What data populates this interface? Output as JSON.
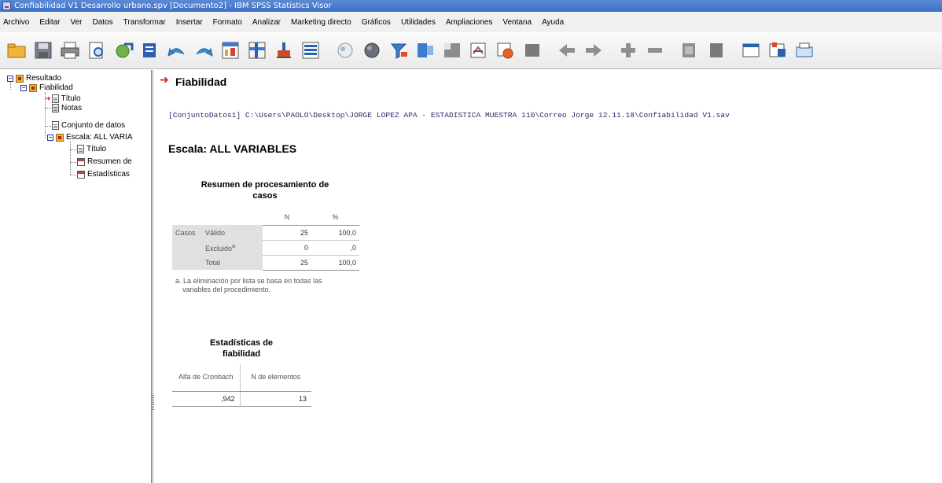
{
  "window": {
    "title": "Confiabilidad V1 Desarrollo urbano.spv [Documento2] - IBM SPSS Statistics Visor"
  },
  "menu": [
    "Archivo",
    "Editar",
    "Ver",
    "Datos",
    "Transformar",
    "Insertar",
    "Formato",
    "Analizar",
    "Marketing directo",
    "Gráficos",
    "Utilidades",
    "Ampliaciones",
    "Ventana",
    "Ayuda"
  ],
  "toolbar": {
    "icons": [
      "open-icon",
      "save-icon",
      "print-icon",
      "print-preview-icon",
      "export-icon",
      "recall-dialog-icon",
      "undo-icon",
      "redo-icon",
      "goto-data-icon",
      "goto-case-icon",
      "goto-variable-icon",
      "variables-icon",
      "designate-window-icon",
      "show-all-icon",
      "insert-output-icon",
      "select-last-output-icon",
      "create-edit-icon",
      "run-icon",
      "stop-icon",
      "promote-icon",
      "demote-icon",
      "expand-icon",
      "collapse-icon",
      "show-icon",
      "hide-icon",
      "insert-heading-icon",
      "insert-title-icon",
      "insert-text-icon"
    ]
  },
  "tree": {
    "root": "Resultado",
    "fiabilidad": "Fiabilidad",
    "titulo": "Título",
    "notas": "Notas",
    "conjunto": "Conjunto de datos",
    "escala": "Escala: ALL VARIA",
    "titulo2": "Título",
    "resumen": "Resumen de",
    "estadisticas": "Estadísticas"
  },
  "content": {
    "heading": "Fiabilidad",
    "syntax": "[ConjuntoDatos1] C:\\Users\\PAOLO\\Desktop\\JORGE LOPEZ APA - ESTADISTICA MUESTRA 110\\Correo Jorge 12.11.18\\Confiabilidad V1.sav",
    "scale_title": "Escala: ALL VARIABLES",
    "summary": {
      "title_line1": "Resumen de procesamiento de",
      "title_line2": "casos",
      "col_n": "N",
      "col_pct": "%",
      "row_group": "Casos",
      "rows": [
        {
          "label": "Válido",
          "n": "25",
          "pct": "100,0"
        },
        {
          "label": "Excluido",
          "sup": "a",
          "n": "0",
          "pct": ",0"
        },
        {
          "label": "Total",
          "n": "25",
          "pct": "100,0"
        }
      ],
      "footnote": "a. La eliminación por lista se basa en todas las variables del procedimiento."
    },
    "reliability": {
      "title_line1": "Estadísticas de",
      "title_line2": "fiabilidad",
      "col1": "Alfa de Cronbach",
      "col2": "N de elementos",
      "alpha": ",942",
      "n_items": "13"
    }
  }
}
